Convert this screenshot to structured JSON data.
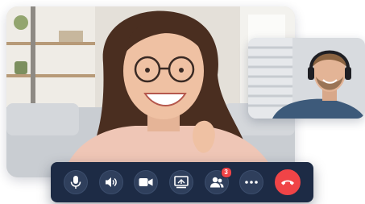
{
  "call": {
    "participants_badge_count": "3",
    "main_participant": "woman-with-glasses",
    "pip_participant": "man-with-headset"
  },
  "controls": [
    {
      "name": "microphone-button",
      "icon": "microphone-icon"
    },
    {
      "name": "speaker-button",
      "icon": "speaker-icon"
    },
    {
      "name": "camera-button",
      "icon": "video-camera-icon"
    },
    {
      "name": "screen-share-button",
      "icon": "screen-share-icon"
    },
    {
      "name": "participants-button",
      "icon": "participants-icon"
    },
    {
      "name": "more-options-button",
      "icon": "more-dots-icon"
    },
    {
      "name": "end-call-button",
      "icon": "phone-hangup-icon"
    }
  ],
  "colors": {
    "control_bar": "#1d2b45",
    "control_button": "#2f3f5c",
    "end_call": "#f04447",
    "badge": "#f04447",
    "icon": "#ffffff"
  }
}
